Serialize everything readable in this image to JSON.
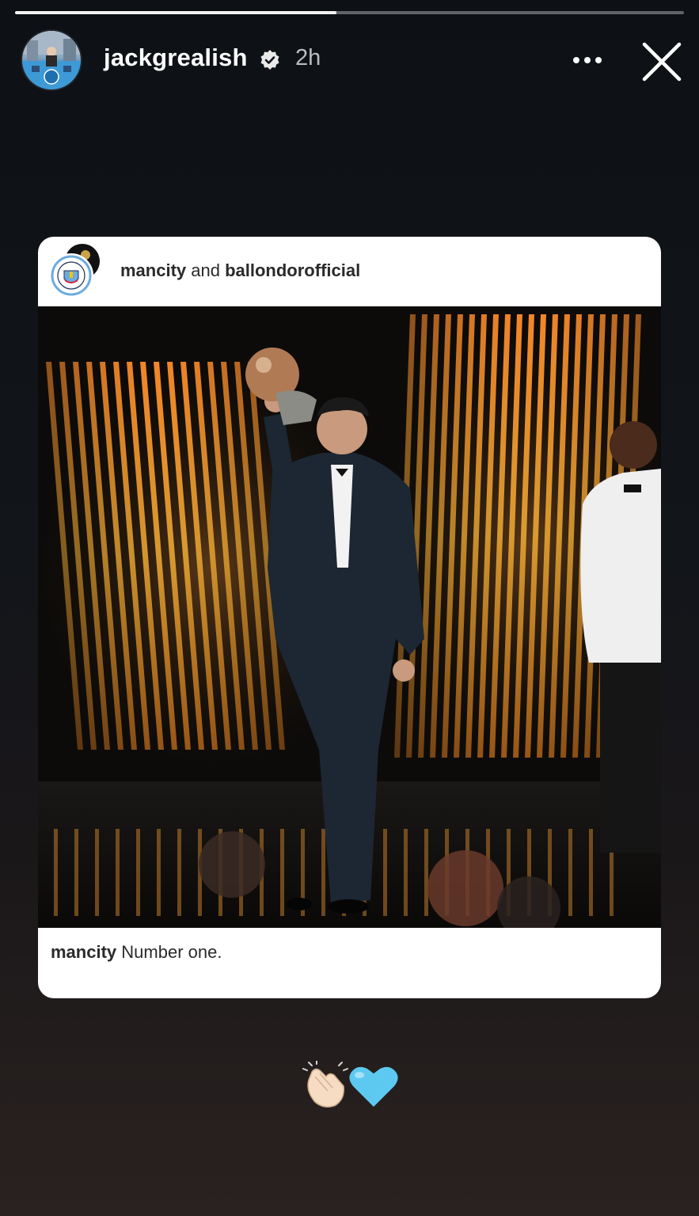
{
  "story": {
    "progress": 0.48,
    "username": "jackgrealish",
    "verified": true,
    "time": "2h",
    "more_icon": "more-horizontal-icon",
    "close_icon": "close-icon"
  },
  "shared_post": {
    "authors": [
      "mancity",
      "ballondorofficial"
    ],
    "joiner": " and ",
    "photo_description_icon": "ballon-dor-ceremony-photo",
    "caption_user": "mancity",
    "caption_text": " Number one."
  },
  "stickers": [
    "clapping-hands-emoji",
    "light-blue-heart-emoji"
  ],
  "colors": {
    "background_top": "#0d1115",
    "background_bottom": "#2a2220",
    "card": "#ffffff",
    "text_dark": "#2a2a2a",
    "heart": "#5ec9f0"
  }
}
